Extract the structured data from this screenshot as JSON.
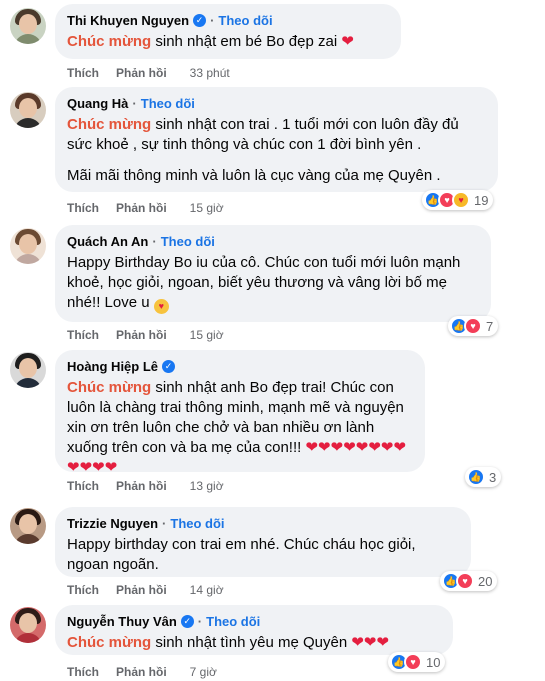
{
  "actions": {
    "like": "Thích",
    "reply": "Phản hồi"
  },
  "follow_label": "Theo dõi",
  "separator": "·",
  "comments": [
    {
      "name": "Thi Khuyen Nguyen",
      "verified": true,
      "highlight": "Chúc mừng",
      "lines": [
        " sinh nhật em bé Bo đẹp zai "
      ],
      "time": "33 phút",
      "reactions": null
    },
    {
      "name": "Quang Hà",
      "verified": false,
      "highlight": "Chúc mừng",
      "paragraph1": " sinh nhật con trai . 1 tuổi mới con luôn đầy đủ sức khoẻ , sự tinh thông và chúc con 1 đời bình yên .",
      "paragraph2": "Mãi mãi thông minh và luôn là cục vàng của mẹ Quyên .",
      "time": "15 giờ",
      "reactions": {
        "icons": [
          "like-icon",
          "love-icon",
          "care-icon"
        ],
        "count": "19"
      }
    },
    {
      "name": "Quách An An",
      "verified": false,
      "text": "Happy Birthday Bo iu của cô. Chúc con tuổi mới luôn mạnh khoẻ, học giỏi, ngoan, biết yêu thương và vâng lời bố mẹ nhé!! Love u ",
      "time": "15 giờ",
      "reactions": {
        "icons": [
          "like-icon",
          "love-icon"
        ],
        "count": "7"
      }
    },
    {
      "name": "Hoàng Hiệp Lê",
      "verified": true,
      "highlight": "Chúc mừng",
      "text": " sinh nhật anh Bo đẹp trai! Chúc con luôn là chàng trai thông minh, mạnh mẽ và nguyện xin ơn trên luôn che chở và ban nhiều ơn lành xuống trên con và ba mẹ của con!!! ",
      "hearts": "❤❤❤❤❤❤❤❤❤❤❤❤",
      "time": "13 giờ",
      "reactions": {
        "icons": [
          "like-icon"
        ],
        "count": "3"
      }
    },
    {
      "name": "Trizzie Nguyen",
      "verified": false,
      "text": "Happy birthday con trai em nhé. Chúc cháu học giỏi, ngoan ngoãn.",
      "time": "14 giờ",
      "reactions": {
        "icons": [
          "like-icon",
          "love-icon"
        ],
        "count": "20"
      }
    },
    {
      "name": "Nguyễn Thuy Vân",
      "verified": true,
      "highlight": "Chúc mừng",
      "text": " sinh nhật tình yêu mẹ Quyên ",
      "hearts": "❤❤❤",
      "time": "7 giờ",
      "reactions": {
        "icons": [
          "like-icon",
          "love-icon"
        ],
        "count": "10"
      }
    }
  ],
  "colors": {
    "highlight": "#e4553b",
    "follow": "#1b74e4",
    "bubble": "#f0f2f5",
    "like": "#1877f2",
    "love": "#f33e58"
  }
}
